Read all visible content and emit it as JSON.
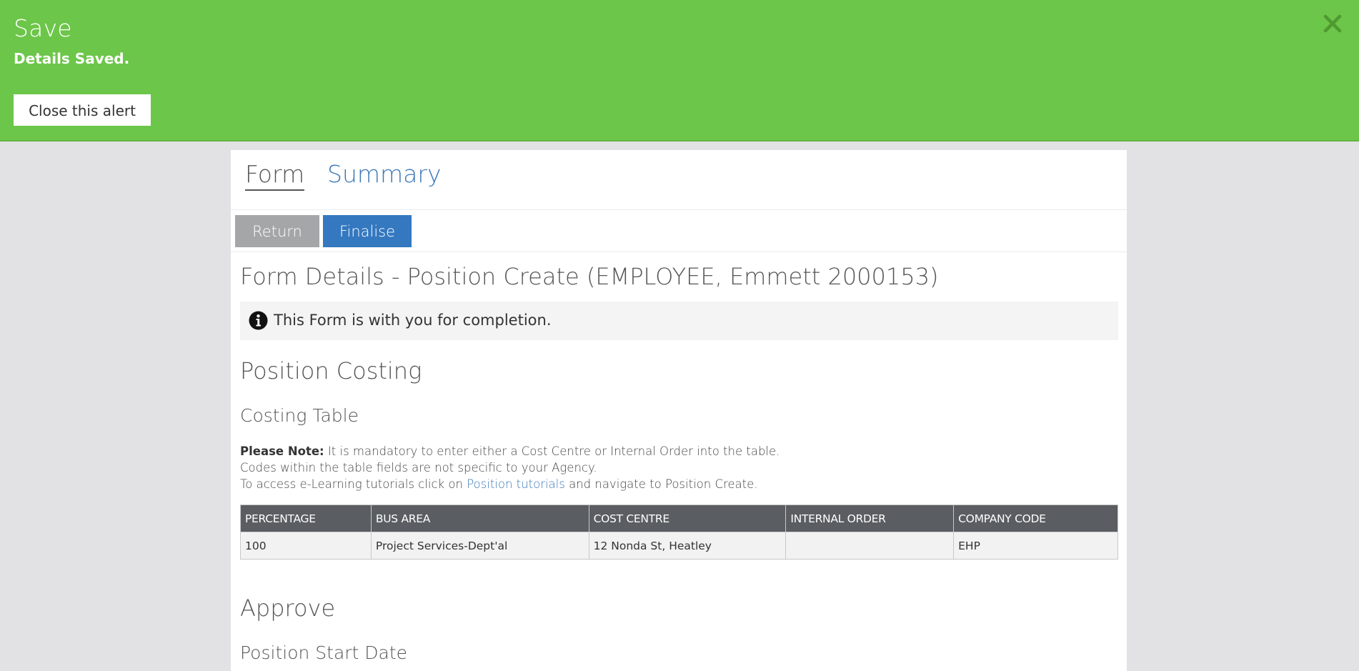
{
  "alert": {
    "title": "Save",
    "message": "Details Saved.",
    "close_label": "Close this alert",
    "background": "#6cc649",
    "dismiss_icon": "close-icon"
  },
  "tabs": [
    {
      "label": "Form",
      "active": true
    },
    {
      "label": "Summary",
      "active": false
    }
  ],
  "toolbar": {
    "return_label": "Return",
    "finalise_label": "Finalise"
  },
  "page": {
    "title": "Form Details - Position Create (EMPLOYEE, Emmett 2000153)",
    "info_icon": "info-icon",
    "info_text": "This Form is with you for completion."
  },
  "costing": {
    "section_title": "Position Costing",
    "table_title": "Costing Table",
    "note_label": "Please Note:",
    "note_text": " It is mandatory to enter either a Cost Centre or Internal Order into the table.",
    "line2": "Codes within the table fields are not specific to your Agency.",
    "line3_prefix": "To access e-Learning tutorials click on ",
    "line3_link": "Position tutorials",
    "line3_suffix": " and navigate to Position Create.",
    "columns": [
      "PERCENTAGE",
      "BUS AREA",
      "COST CENTRE",
      "INTERNAL ORDER",
      "COMPANY CODE"
    ],
    "rows": [
      [
        "100",
        "Project Services-Dept'al",
        "12 Nonda St, Heatley",
        "",
        "EHP"
      ]
    ]
  },
  "approve": {
    "section_title": "Approve",
    "sub_title": "Position Start Date"
  }
}
